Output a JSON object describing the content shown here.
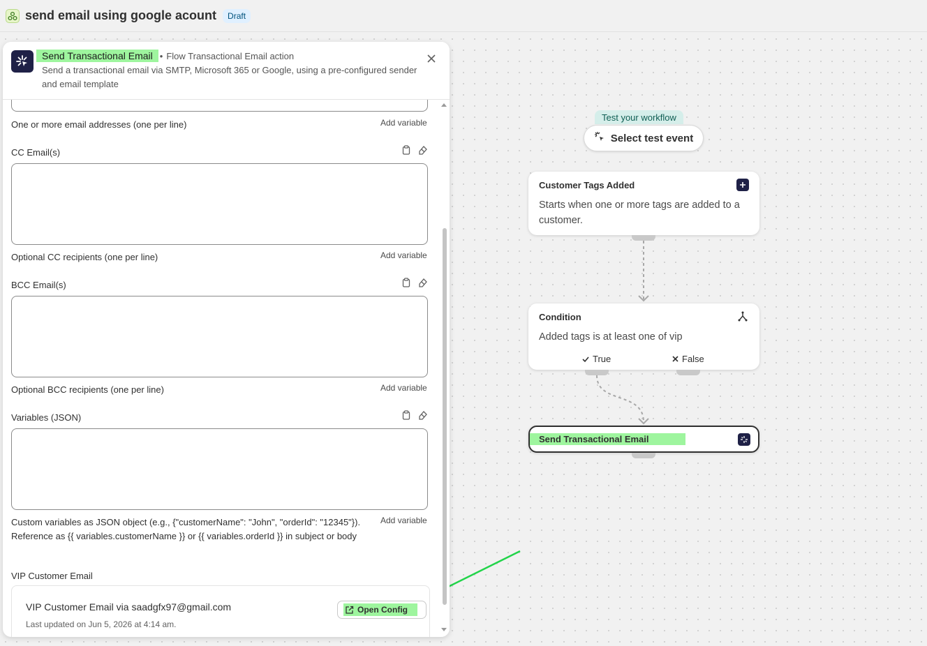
{
  "header": {
    "title": "send email using google acount",
    "badge": "Draft"
  },
  "panel": {
    "title": "Send Transactional Email",
    "separator": "•",
    "subtitle": "Flow Transactional Email action",
    "description": "Send a transactional email via SMTP, Microsoft 365 or Google, using a pre-configured sender and email template",
    "to_help": "One or more email addresses (one per line)",
    "add_variable": "Add variable",
    "cc": {
      "label": "CC Email(s)",
      "help": "Optional CC recipients (one per line)"
    },
    "bcc": {
      "label": "BCC Email(s)",
      "help": "Optional BCC recipients (one per line)"
    },
    "variables": {
      "label": "Variables (JSON)",
      "help": "Custom variables as JSON object (e.g., {\"customerName\": \"John\", \"orderId\": \"12345\"}). Reference as {{ variables.customerName }} or {{ variables.orderId }} in subject or body"
    },
    "template": {
      "label": "VIP Customer Email",
      "card_title": "VIP Customer Email via saadgfx97@gmail.com",
      "card_sub": "Last updated on Jun 5, 2026 at 4:14 am.",
      "open_config": "Open Config"
    }
  },
  "canvas": {
    "test_label": "Test your workflow",
    "test_button": "Select test event",
    "trigger": {
      "title": "Customer Tags Added",
      "description": "Starts when one or more tags are added to a customer."
    },
    "condition": {
      "title": "Condition",
      "description": "Added tags is at least one of vip",
      "true_label": "True",
      "false_label": "False"
    },
    "action": {
      "title": "Send Transactional Email"
    }
  },
  "colors": {
    "highlight": "#9ef59e",
    "arrow": "#22d44a",
    "icon_bg": "#1f2147"
  },
  "icons": [
    "workflow-app-icon",
    "sparkle-icon",
    "close-icon",
    "clipboard-icon",
    "eraser-icon",
    "external-link-icon",
    "cursor-sparkle-icon",
    "branch-icon",
    "check-icon",
    "x-icon"
  ]
}
